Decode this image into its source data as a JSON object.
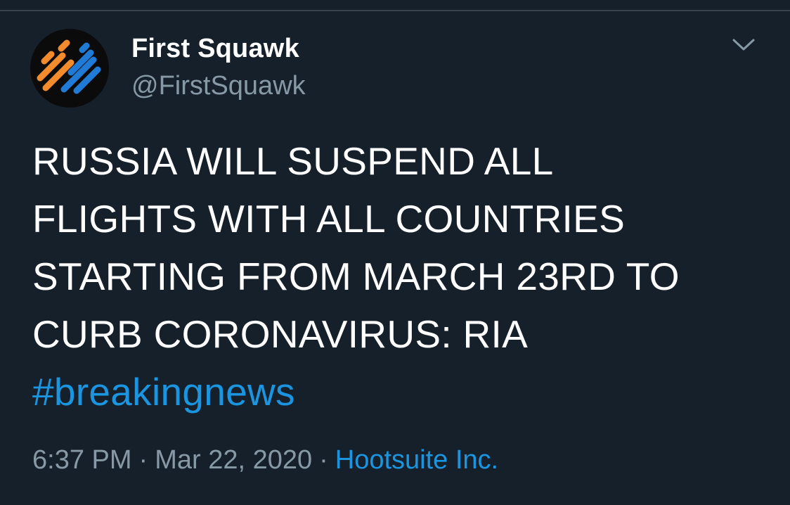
{
  "colors": {
    "background": "#15202b",
    "primary_text": "#ffffff",
    "secondary_text": "#8899a6",
    "link": "#1b95e0",
    "divider": "#38444d"
  },
  "author": {
    "display_name": "First Squawk",
    "handle": "@FirstSquawk",
    "avatar_icon": "first-squawk-logo"
  },
  "tweet": {
    "text_lines": [
      "RUSSIA WILL SUSPEND ALL",
      "FLIGHTS WITH ALL COUNTRIES",
      "STARTING FROM MARCH 23RD TO",
      "CURB CORONAVIRUS: RIA"
    ],
    "hashtag": "#breakingnews"
  },
  "meta": {
    "time": "6:37 PM",
    "separator": "·",
    "date": "Mar 22, 2020",
    "source": "Hootsuite Inc."
  },
  "actions": {
    "more_icon": "chevron-down-icon"
  }
}
